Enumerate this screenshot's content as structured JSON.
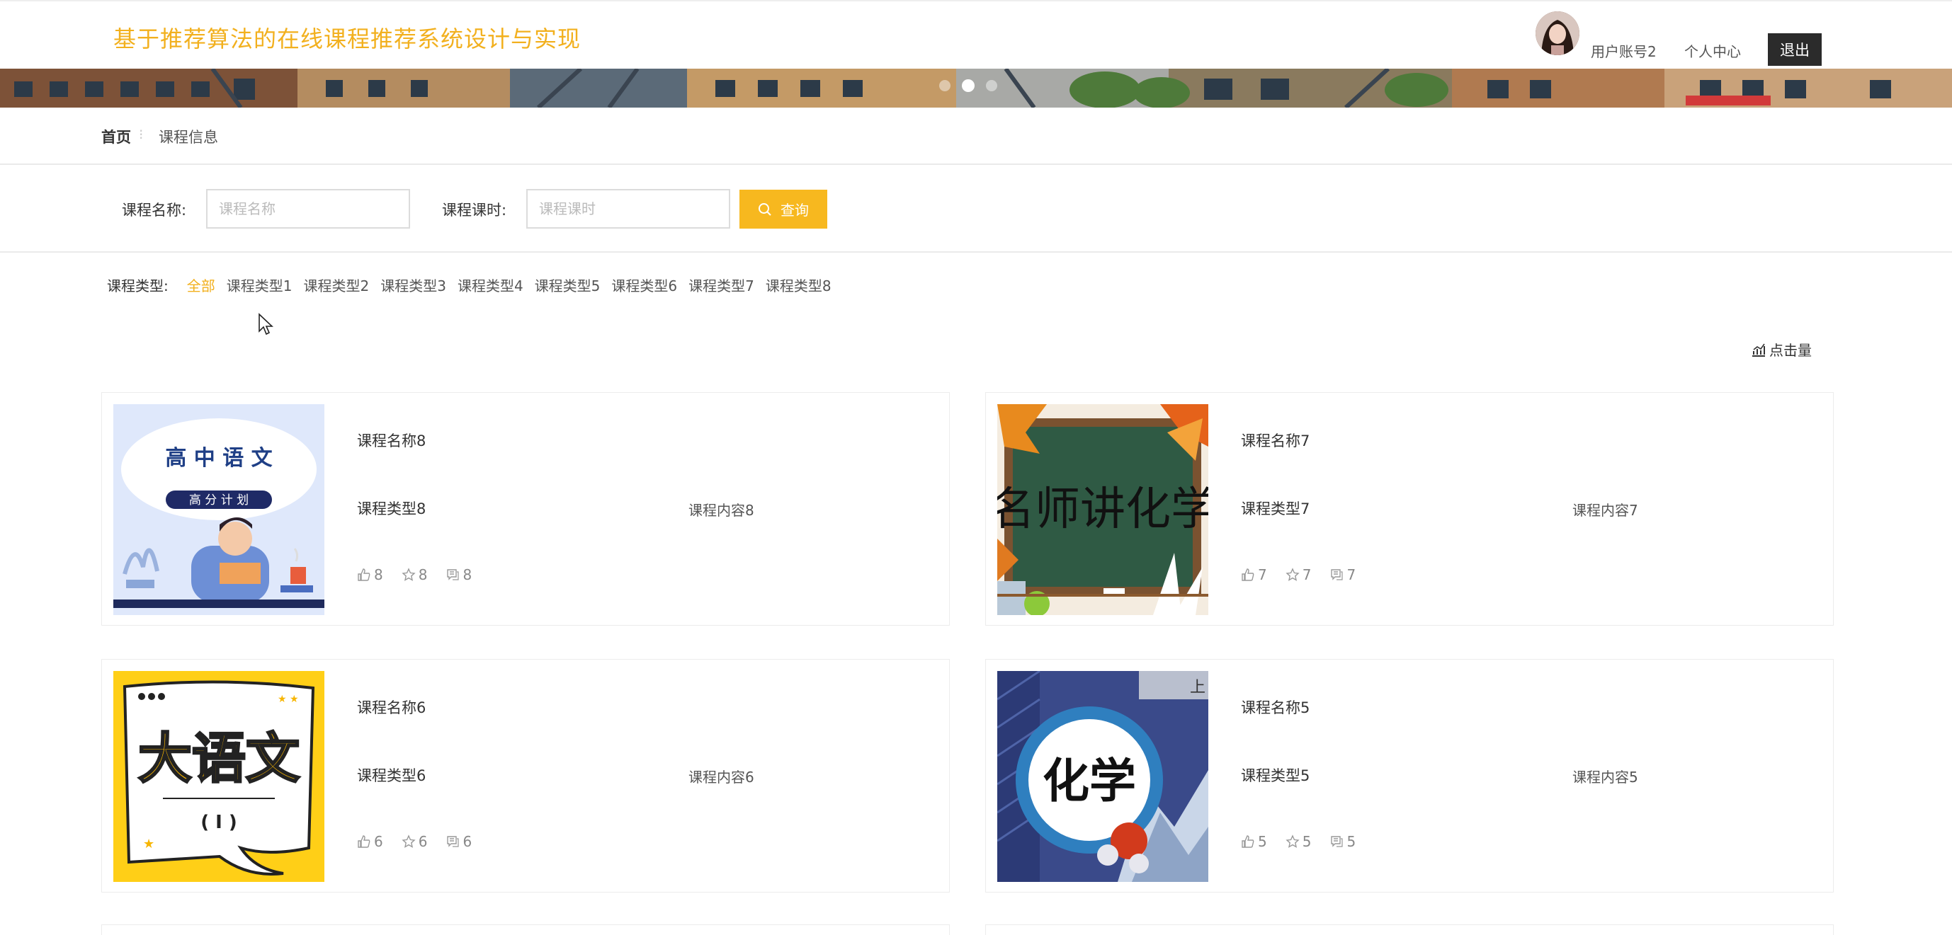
{
  "header": {
    "title": "基于推荐算法的在线课程推荐系统设计与实现",
    "user": "用户账号2",
    "profile": "个人中心",
    "logout": "退出"
  },
  "breadcrumb": {
    "home": "首页",
    "current": "课程信息"
  },
  "search": {
    "name_label": "课程名称:",
    "name_placeholder": "课程名称",
    "name_value": "",
    "hours_label": "课程课时:",
    "hours_placeholder": "课程课时",
    "hours_value": "",
    "button": "查询"
  },
  "categories": {
    "label": "课程类型:",
    "items": [
      "全部",
      "课程类型1",
      "课程类型2",
      "课程类型3",
      "课程类型4",
      "课程类型5",
      "课程类型6",
      "课程类型7",
      "课程类型8"
    ],
    "active": "全部"
  },
  "sort": {
    "label": "点击量"
  },
  "courses": [
    {
      "name": "课程名称8",
      "type": "课程类型8",
      "content": "课程内容8",
      "likes": "8",
      "favorites": "8",
      "comments": "8",
      "image": "高中语文 高分计划"
    },
    {
      "name": "课程名称7",
      "type": "课程类型7",
      "content": "课程内容7",
      "likes": "7",
      "favorites": "7",
      "comments": "7",
      "image": "名师讲化学"
    },
    {
      "name": "课程名称6",
      "type": "课程类型6",
      "content": "课程内容6",
      "likes": "6",
      "favorites": "6",
      "comments": "6",
      "image": "大语文 (1)"
    },
    {
      "name": "课程名称5",
      "type": "课程类型5",
      "content": "课程内容5",
      "likes": "5",
      "favorites": "5",
      "comments": "5",
      "image": "化学"
    }
  ],
  "colors": {
    "accent": "#f2b01e",
    "button": "#f7b81f",
    "logout": "#2b2b2b"
  },
  "banner": {
    "slides": 3,
    "active_slide": 2
  }
}
